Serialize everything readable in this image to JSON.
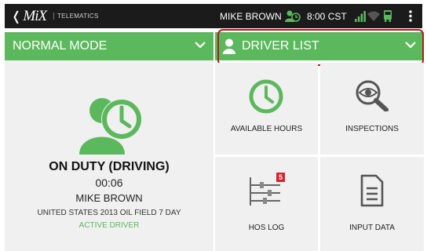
{
  "topbar": {
    "logo_text": "MiX",
    "back_glyph": "❬",
    "logo_subtitle": "TELEMATICS",
    "user_name": "MIKE BROWN",
    "time": "8:00 CST",
    "icons": [
      "back-chevron-icon",
      "driver-clock-icon",
      "signal-icon",
      "wifi-icon",
      "truck-icon",
      "overflow-menu-icon"
    ]
  },
  "mode_panel": {
    "header_label": "NORMAL MODE",
    "status": "ON DUTY (DRIVING)",
    "duration": "00:06",
    "driver_name": "MIKE BROWN",
    "ruleset": "UNITED STATES 2013 OIL FIELD 7 DAY",
    "driver_role": "ACTIVE DRIVER"
  },
  "driver_list": {
    "header_label": "DRIVER LIST",
    "highlighted": true
  },
  "tiles": [
    {
      "label": "AVAILABLE HOURS",
      "icon": "clock-icon"
    },
    {
      "label": "INSPECTIONS",
      "icon": "magnifier-eye-icon"
    },
    {
      "label": "HOS LOG",
      "icon": "log-sliders-icon",
      "badge": "5"
    },
    {
      "label": "INPUT DATA",
      "icon": "document-icon"
    }
  ],
  "colors": {
    "accent_green": "#5cb85c",
    "top_bar": "#1b1b1b",
    "panel_bg": "#f0f0f0",
    "highlight_red": "#b31b1b",
    "badge_red": "#d9232e",
    "icon_grey": "#555555"
  }
}
